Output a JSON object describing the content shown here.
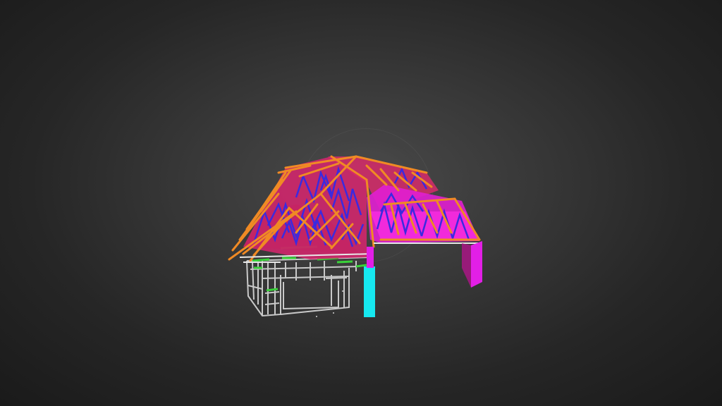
{
  "viewer": {
    "colors": {
      "background_center": "#4a4a4a",
      "background_edge": "#1a1a1a",
      "roof_sheet": "#e0308a",
      "roof_sheet_bright": "#ff1fd0",
      "rafters": "#f08a24",
      "truss_webs": "#3a2ae0",
      "walls": "#c9c9c9",
      "nogging": "#3ad23a",
      "column_cyan": "#16e8f0",
      "column_magenta": "#e21fe6"
    }
  }
}
